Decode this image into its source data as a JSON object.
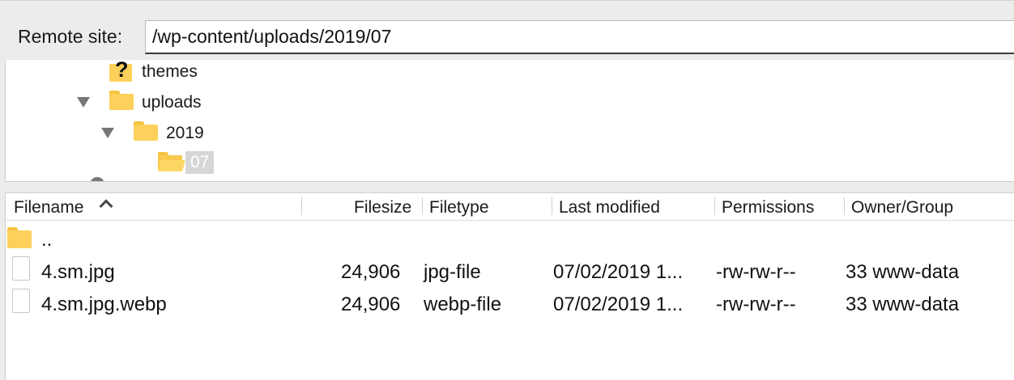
{
  "remote_site": {
    "label": "Remote site:",
    "path": "/wp-content/uploads/2019/07"
  },
  "tree": {
    "items": [
      {
        "label": "themes",
        "icon": "unknown-folder-icon",
        "state": "unknown"
      },
      {
        "label": "uploads",
        "icon": "folder-icon",
        "state": "expanded"
      },
      {
        "label": "2019",
        "icon": "folder-icon",
        "state": "expanded"
      },
      {
        "label": "07",
        "icon": "open-folder-icon",
        "state": "selected"
      }
    ]
  },
  "file_list": {
    "columns": [
      "Filename",
      "Filesize",
      "Filetype",
      "Last modified",
      "Permissions",
      "Owner/Group"
    ],
    "sort": {
      "column": "Filename",
      "direction": "ascending",
      "icon": "chevron-up-icon"
    },
    "rows": [
      {
        "filename": "..",
        "filesize": "",
        "filetype": "",
        "last_modified": "",
        "permissions": "",
        "owner_group": "",
        "icon": "folder-icon"
      },
      {
        "filename": "4.sm.jpg",
        "filesize": "24,906",
        "filetype": "jpg-file",
        "last_modified": "07/02/2019 1...",
        "permissions": "-rw-rw-r--",
        "owner_group": "33 www-data",
        "icon": "file-icon"
      },
      {
        "filename": "4.sm.jpg.webp",
        "filesize": "24,906",
        "filetype": "webp-file",
        "last_modified": "07/02/2019 1...",
        "permissions": "-rw-rw-r--",
        "owner_group": "33 www-data",
        "icon": "file-icon"
      }
    ]
  },
  "colors": {
    "folder": "#fcd05a",
    "selection": "#d6d6d6",
    "background": "#ececec"
  }
}
